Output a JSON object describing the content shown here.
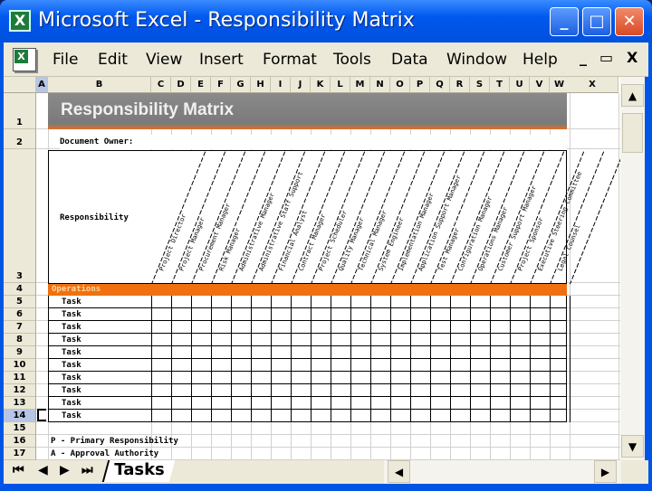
{
  "window": {
    "title": "Microsoft Excel - Responsibility Matrix"
  },
  "menu": [
    "File",
    "Edit",
    "View",
    "Insert",
    "Format",
    "Tools",
    "Data",
    "Window",
    "Help"
  ],
  "menu_controls": {
    "minimize": "_",
    "restore": "🗗",
    "close": "X"
  },
  "columns": [
    "A",
    "B",
    "C",
    "D",
    "E",
    "F",
    "G",
    "H",
    "I",
    "J",
    "K",
    "L",
    "M",
    "N",
    "O",
    "P",
    "Q",
    "R",
    "S",
    "T",
    "U",
    "V",
    "W",
    "X"
  ],
  "rows": [
    "1",
    "2",
    "3",
    "4",
    "5",
    "6",
    "7",
    "8",
    "9",
    "10",
    "11",
    "12",
    "13",
    "14",
    "15",
    "16",
    "17"
  ],
  "sheet": {
    "title": "Responsibility Matrix",
    "document_owner_label": "Document Owner:",
    "responsibility_label": "Responsibility",
    "roles": [
      "Project Director",
      "Project Manager",
      "Procurement Manager",
      "Risk Manager",
      "Administrative Manager",
      "Administrative Staff Support",
      "Financial Analyst",
      "Contract Manager",
      "Project Scheduler",
      "Quality Manager",
      "Technical Manager",
      "System Engineer",
      "Implementation Manager",
      "Application Support Manager",
      "Test Manager",
      "Configuration Manager",
      "Operations Manager",
      "Customer Support Manager",
      "Project Sponsor",
      "Executive Steering Committee",
      "Legal Counsel"
    ],
    "section": "Operations",
    "tasks": [
      "Task",
      "Task",
      "Task",
      "Task",
      "Task",
      "Task",
      "Task",
      "Task",
      "Task",
      "Task"
    ],
    "legend": [
      "P - Primary Responsibility",
      "A - Approval Authority"
    ]
  },
  "sheet_tabs": [
    "Tasks"
  ],
  "colors": {
    "banner": "#7d7d7d",
    "accent_orange": "#f07010",
    "titlebar": "#0058ee"
  }
}
